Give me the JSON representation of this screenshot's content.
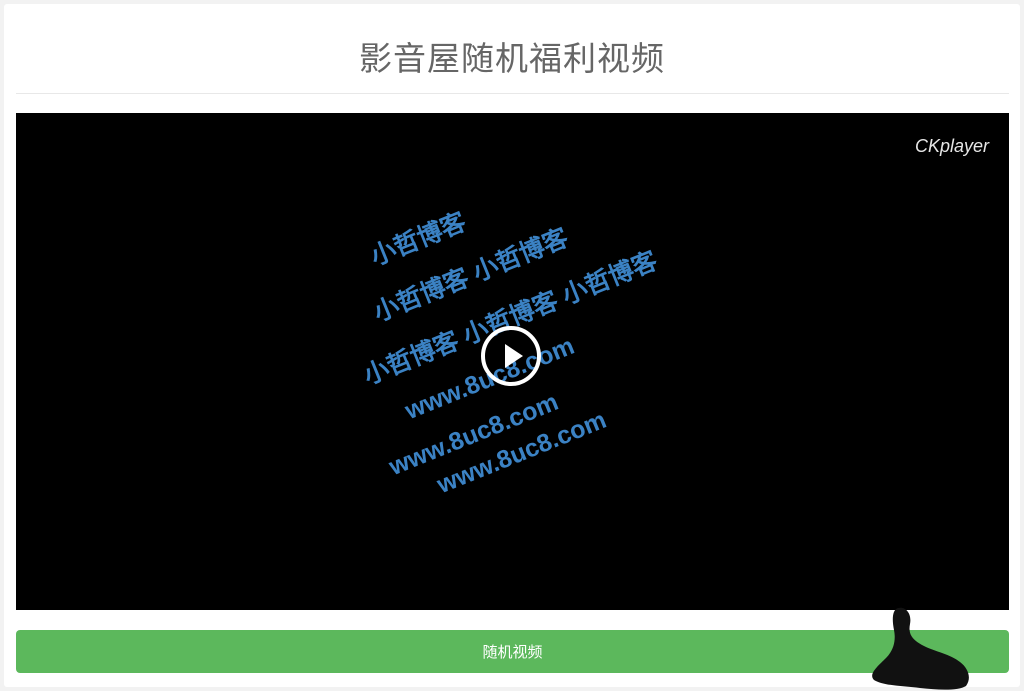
{
  "page": {
    "title": "影音屋随机福利视频"
  },
  "player": {
    "logo": "CKplayer",
    "watermark_lines": [
      "小哲博客",
      "小哲博客 小哲博客",
      "小哲博客 小哲博客 小哲博客",
      "www.8uc8.com",
      "www.8uc8.com",
      "www.8uc8.com"
    ],
    "play_icon": "play-circle-icon"
  },
  "controls": {
    "random_button_label": "随机视频"
  },
  "colors": {
    "button_green": "#5cb85c",
    "watermark_blue": "#3b82c4",
    "player_bg": "#000000",
    "title_gray": "#666666"
  }
}
